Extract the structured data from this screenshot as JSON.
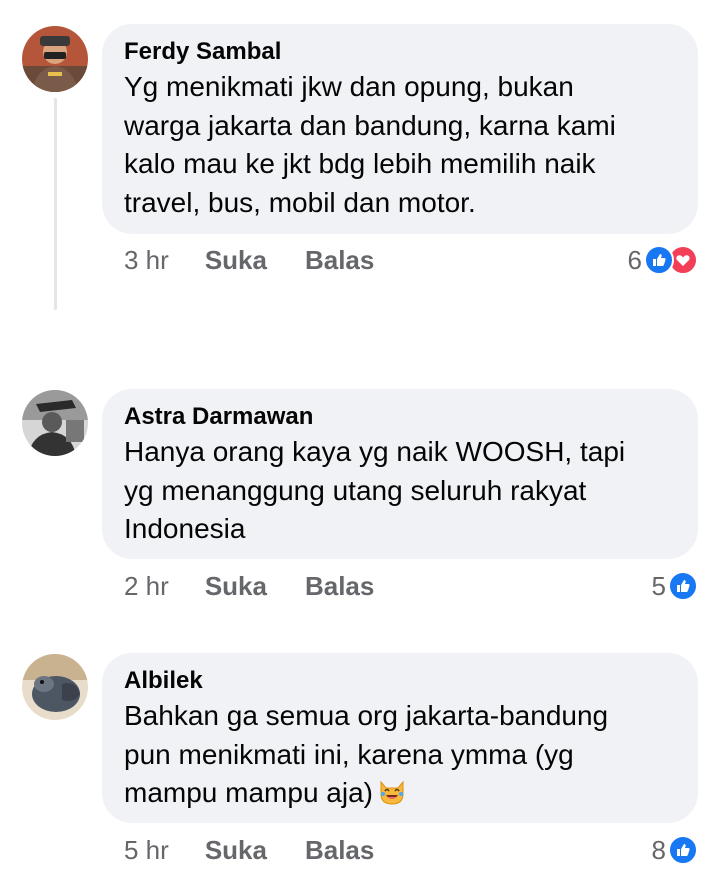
{
  "comments": [
    {
      "author": "Ferdy Sambal",
      "text": "Yg menikmati jkw dan opung, bukan\nwarga jakarta dan bandung, karna kami\nkalo mau ke jkt bdg lebih memilih naik\ntravel, bus, mobil dan motor.",
      "time": "3 hr",
      "like_label": "Suka",
      "reply_label": "Balas",
      "reaction_count": "6",
      "reactions": [
        "like-icon",
        "love-icon"
      ]
    },
    {
      "author": "Astra Darmawan",
      "text": "Hanya orang kaya yg naik WOOSH, tapi\nyg menanggung utang seluruh rakyat\nIndonesia",
      "time": "2 hr",
      "like_label": "Suka",
      "reply_label": "Balas",
      "reaction_count": "5",
      "reactions": [
        "like-icon"
      ]
    },
    {
      "author": "Albilek",
      "text": "Bahkan ga semua org jakarta-bandung\npun menikmati ini, karena ymma (yg\nmampu mampu aja)",
      "time": "5 hr",
      "like_label": "Suka",
      "reply_label": "Balas",
      "reaction_count": "8",
      "reactions": [
        "like-icon"
      ],
      "trailing_emoji": "laughing-cat-emoji"
    }
  ],
  "colors": {
    "bubble": "#f0f2f5",
    "meta_text": "#65676b",
    "like": "#1877f2",
    "love": "#f33e58"
  }
}
